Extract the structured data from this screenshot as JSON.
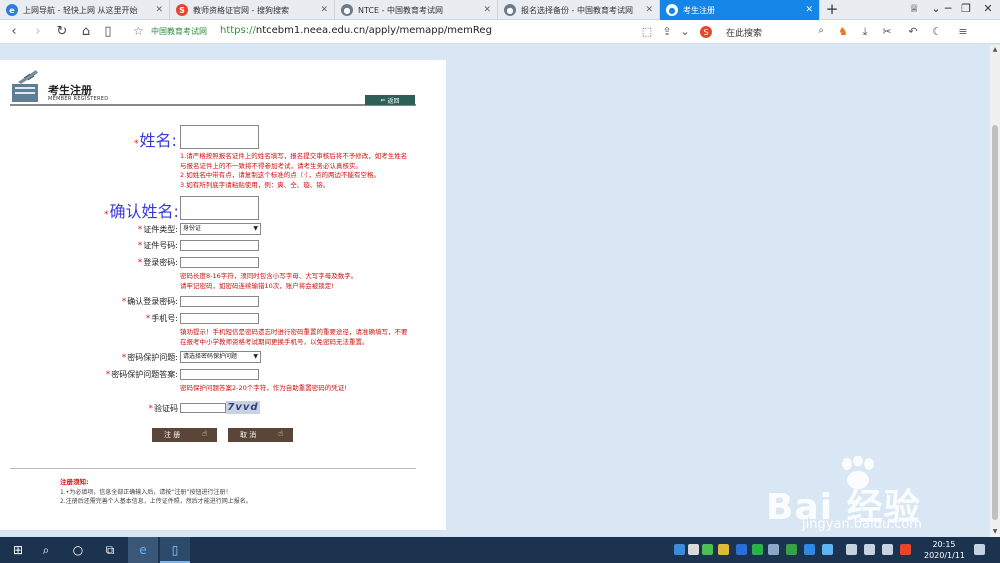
{
  "tabs": [
    {
      "label": "上网导航 - 轻快上网 从这里开始",
      "icon": "ie-icon",
      "color": "#2a7fd6",
      "glyph": "e"
    },
    {
      "label": "教师资格证官网 - 搜狗搜索",
      "icon": "sogou-icon",
      "color": "#e8462c",
      "glyph": "S"
    },
    {
      "label": "NTCE - 中国教育考试网",
      "icon": "globe-icon",
      "color": "#6b7b8c",
      "glyph": "●"
    },
    {
      "label": "报名选择备份 - 中国教育考试网",
      "icon": "globe-icon",
      "color": "#6b7b8c",
      "glyph": "●"
    },
    {
      "label": "考生注册",
      "icon": "globe-icon",
      "color": "#ffffff",
      "glyph": "●",
      "active": true
    }
  ],
  "address_bar": {
    "site_name": "中国教育考试网",
    "url_scheme": "https://",
    "url_rest": "ntcebm1.neea.edu.cn/apply/memapp/memReg",
    "search_placeholder": "在此搜索"
  },
  "page": {
    "header_title": "考生注册",
    "header_subtitle": "MEMBER REGISTERED",
    "back_label": "返回",
    "fields": {
      "name": "姓名:",
      "confirm_name": "确认姓名:",
      "id_type": "证件类型:",
      "id_number": "证件号码:",
      "password": "登录密码:",
      "confirm_password": "确认登录密码:",
      "phone": "手机号:",
      "security_question": "密码保护问题:",
      "security_answer": "密码保护问题答案:",
      "captcha": "验证码"
    },
    "id_type_value": "身份证",
    "security_question_value": "请选择密码保护问题",
    "captcha_text": "7vvd",
    "name_notes": [
      "1.请严格按照报名证件上的姓名填写，报名提交审核后将不予修改，如考生姓名",
      "与报名证件上的不一致将不得参加考试，请考生务必认真核实。",
      "2.如姓名中带有点，请复制这个标准的点（·），点的两边不能有空格。",
      "3.如有所列底字请粘贴使用，例：奭、仝、璇、镕。"
    ],
    "password_notes": [
      "密码长度8-16字符，须同时包含小写字母、大写字母及数字。",
      "请牢记密码，如密码连续输错10次，账户将会被锁定!"
    ],
    "phone_notes": [
      "镇劝提示！手机短信是密码遗忘时进行密码重置的重要途径，请准确填写，不要",
      "在报考中小学教师资格考试期间更换手机号，以免密码无法重置。"
    ],
    "answer_note": "密码保护问题答案2-20个字符，作为自助重置密码的凭证!",
    "register_label": "注 册",
    "cancel_label": "取 消",
    "notice_title": "注册须知:",
    "notice_lines": [
      "1.•为必填项，信息全部正确输入后，请按“注册”按钮进行注册！",
      "2.注册后还需完善个人基本信息，上传证件照，然后才能进行网上报名。"
    ]
  },
  "watermark": {
    "brand": "Bai  经验",
    "url": "jingyan.baidu.com"
  },
  "taskbar": {
    "time": "20:15",
    "date": "2020/1/11"
  }
}
